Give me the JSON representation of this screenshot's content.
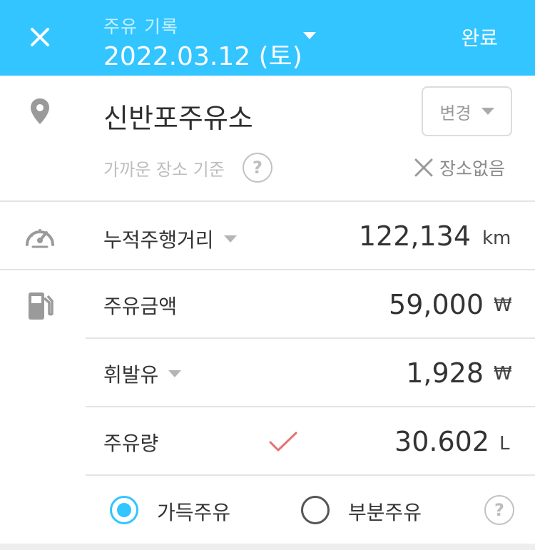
{
  "header": {
    "subtitle": "주유 기록",
    "date": "2022.03.12 (토)",
    "done_label": "완료",
    "background_color": "#32c5ff"
  },
  "location": {
    "icon": "location-pin-icon",
    "station_name": "신반포주유소",
    "change_label": "변경",
    "nearby_label": "가까운 장소 기준",
    "help_glyph": "?",
    "no_place_label": "장소없음"
  },
  "odometer": {
    "icon": "speedometer-icon",
    "label": "누적주행거리",
    "value": "122,134",
    "unit": "km"
  },
  "fuel": {
    "icon": "fuel-pump-icon",
    "amount_label": "주유금액",
    "amount_value": "59,000",
    "amount_unit": "₩",
    "fuel_type_label": "휘발유",
    "price_value": "1,928",
    "price_unit": "₩",
    "volume_label": "주유량",
    "volume_value": "30.602",
    "volume_unit": "L",
    "check_color": "#e57373"
  },
  "fill_mode": {
    "full_label": "가득주유",
    "partial_label": "부분주유",
    "selected": "full",
    "help_glyph": "?"
  }
}
